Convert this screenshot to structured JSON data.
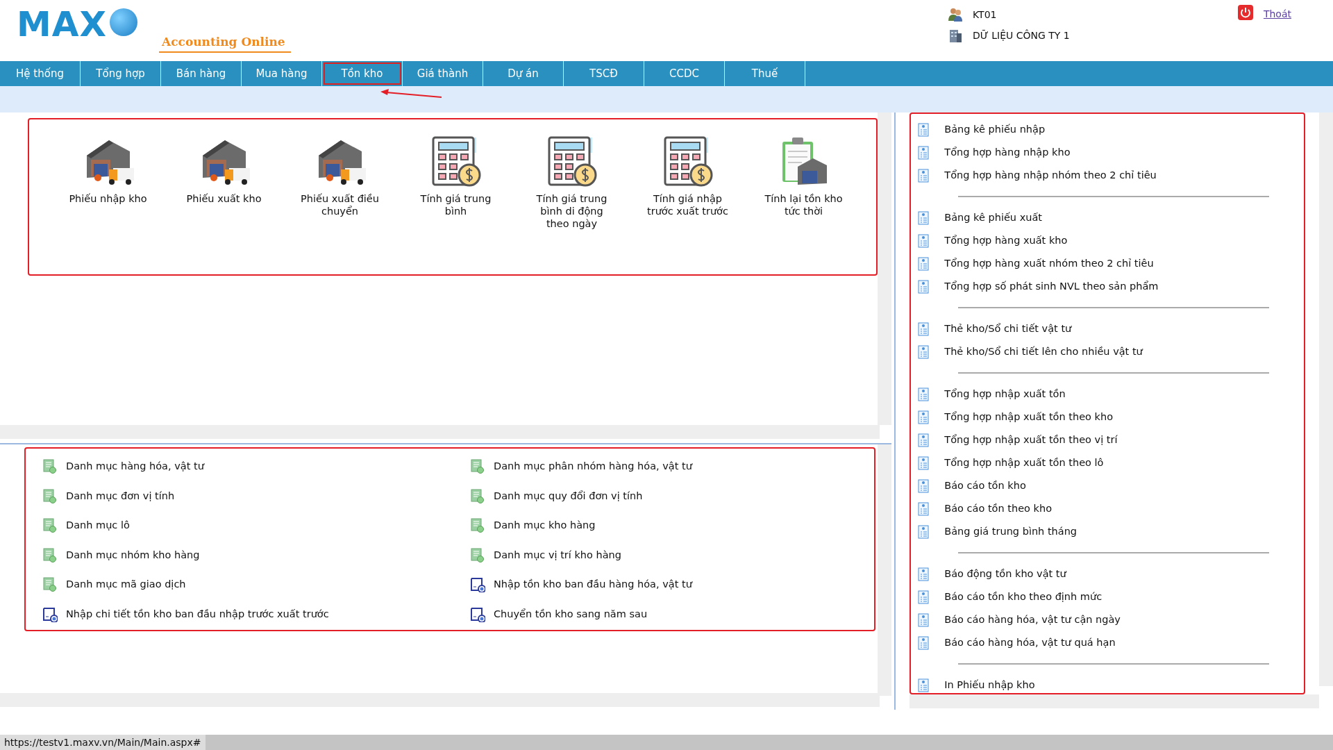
{
  "header": {
    "logo_text": "MAX",
    "logo_tagline": "Accounting Online",
    "user": "KT01",
    "company": "DỮ LIỆU CÔNG TY 1",
    "logout": "Thoát"
  },
  "nav": [
    {
      "label": "Hệ thống",
      "selected": false
    },
    {
      "label": "Tổng hợp",
      "selected": false
    },
    {
      "label": "Bán hàng",
      "selected": false
    },
    {
      "label": "Mua hàng",
      "selected": false
    },
    {
      "label": "Tồn kho",
      "selected": true
    },
    {
      "label": "Giá thành",
      "selected": false
    },
    {
      "label": "Dự án",
      "selected": false
    },
    {
      "label": "TSCĐ",
      "selected": false
    },
    {
      "label": "CCDC",
      "selected": false
    },
    {
      "label": "Thuế",
      "selected": false
    }
  ],
  "tasks": [
    {
      "label": "Phiếu nhập kho",
      "kind": "warehouse"
    },
    {
      "label": "Phiếu xuất kho",
      "kind": "warehouse"
    },
    {
      "label": "Phiếu xuất điều chuyển",
      "kind": "warehouse"
    },
    {
      "label": "Tính giá trung bình",
      "kind": "calculator"
    },
    {
      "label": "Tính giá trung bình di động theo ngày",
      "kind": "calculator"
    },
    {
      "label": "Tính giá nhập trước xuất trước",
      "kind": "calculator"
    },
    {
      "label": "Tính lại tồn kho tức thời",
      "kind": "clipboard"
    }
  ],
  "catalogs": [
    {
      "label": "Danh mục hàng hóa, vật tư",
      "kind": "catalog"
    },
    {
      "label": "Danh mục phân nhóm hàng hóa, vật tư",
      "kind": "catalog"
    },
    {
      "label": "Danh mục đơn vị tính",
      "kind": "catalog"
    },
    {
      "label": "Danh mục quy đổi đơn vị tính",
      "kind": "catalog"
    },
    {
      "label": "Danh mục lô",
      "kind": "catalog"
    },
    {
      "label": "Danh mục kho hàng",
      "kind": "catalog"
    },
    {
      "label": "Danh mục nhóm kho hàng",
      "kind": "catalog"
    },
    {
      "label": "Danh mục vị trí kho hàng",
      "kind": "catalog"
    },
    {
      "label": "Danh mục mã giao dịch",
      "kind": "catalog"
    },
    {
      "label": "Nhập tồn kho ban đầu hàng hóa, vật tư",
      "kind": "entry"
    },
    {
      "label": "Nhập chi tiết tồn kho ban đầu nhập trước xuất trước",
      "kind": "entry"
    },
    {
      "label": "Chuyển tồn kho sang năm sau",
      "kind": "entry"
    }
  ],
  "report_groups": [
    [
      "Bảng kê phiếu nhập",
      "Tổng hợp hàng nhập kho",
      "Tổng hợp hàng nhập nhóm theo 2 chỉ tiêu"
    ],
    [
      "Bảng kê phiếu xuất",
      "Tổng hợp hàng xuất kho",
      "Tổng hợp hàng xuất nhóm theo 2 chỉ tiêu",
      "Tổng hợp số phát sinh NVL theo sản phẩm"
    ],
    [
      "Thẻ kho/Sổ chi tiết vật tư",
      "Thẻ kho/Sổ chi tiết lên cho nhiều vật tư"
    ],
    [
      "Tổng hợp nhập xuất tồn",
      "Tổng hợp nhập xuất tồn theo kho",
      "Tổng hợp nhập xuất tồn theo vị trí",
      "Tổng hợp nhập xuất tồn theo lô",
      "Báo cáo tồn kho",
      "Báo cáo tồn theo kho",
      "Bảng giá trung bình tháng"
    ],
    [
      "Báo động tồn kho vật tư",
      "Báo cáo tồn kho theo định mức",
      "Báo cáo hàng hóa, vật tư cận ngày",
      "Báo cáo hàng hóa, vật tư quá hạn"
    ],
    [
      "In Phiếu nhập kho"
    ]
  ],
  "status_url": "https://testv1.maxv.vn/Main/Main.aspx#"
}
